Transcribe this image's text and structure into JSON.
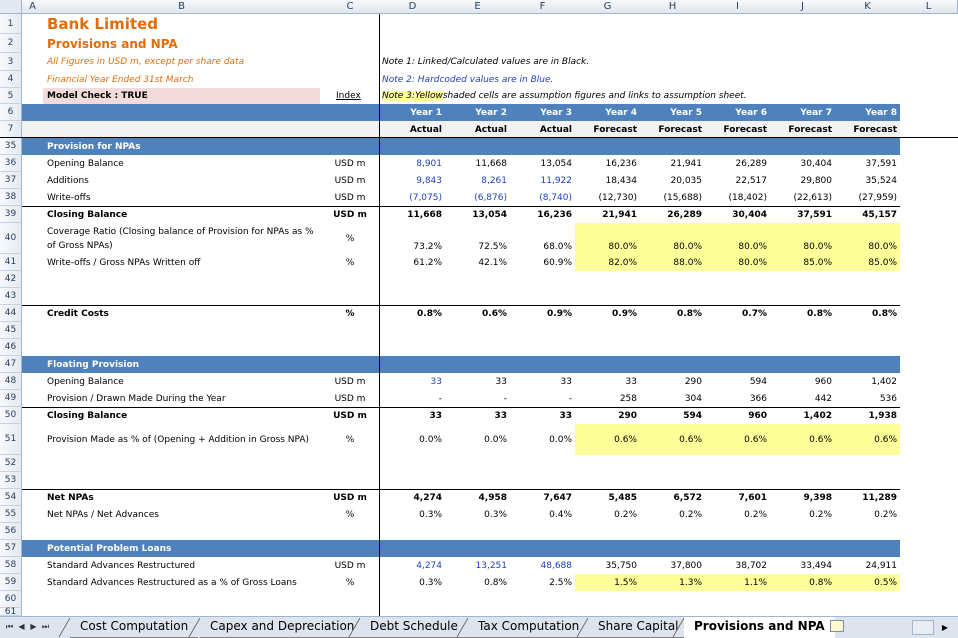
{
  "columns": [
    "A",
    "B",
    "C",
    "D",
    "E",
    "F",
    "G",
    "H",
    "I",
    "J",
    "K",
    "L"
  ],
  "title": "Bank Limited",
  "subtitle": "Provisions and NPA",
  "figures_note": "All Figures in USD m, except per share data",
  "fy_note": "Financial Year Ended 31st March",
  "model_check": "Model Check : TRUE",
  "index_link": "Index",
  "note1": "Note 1: Linked/Calculated values are in Black.",
  "note2": "Note 2: Hardcoded values are in Blue.",
  "note3_prefix": "Note 3: ",
  "note3_yellow": "Yellow",
  "note3_rest": " shaded cells are assumption figures and links to assumption sheet.",
  "years": [
    "Year 1",
    "Year 2",
    "Year 3",
    "Year 4",
    "Year 5",
    "Year 6",
    "Year 7",
    "Year 8"
  ],
  "kinds": [
    "Actual",
    "Actual",
    "Actual",
    "Forecast",
    "Forecast",
    "Forecast",
    "Forecast",
    "Forecast"
  ],
  "row_numbers": [
    "1",
    "2",
    "3",
    "4",
    "5",
    "6",
    "7",
    "35",
    "36",
    "37",
    "38",
    "39",
    "40",
    "41",
    "42",
    "43",
    "44",
    "45",
    "46",
    "47",
    "48",
    "49",
    "50",
    "51",
    "52",
    "53",
    "54",
    "55",
    "56",
    "57",
    "58",
    "59",
    "60",
    "61"
  ],
  "sections": {
    "provision": "Provision for NPAs",
    "floating": "Floating Provision",
    "ppl": "Potential Problem Loans"
  },
  "lines": {
    "opening": {
      "label": "Opening Balance",
      "unit": "USD m",
      "values": [
        "8,901",
        "11,668",
        "13,054",
        "16,236",
        "21,941",
        "26,289",
        "30,404",
        "37,591"
      ]
    },
    "additions": {
      "label": "Additions",
      "unit": "USD m",
      "values": [
        "9,843",
        "8,261",
        "11,922",
        "18,434",
        "20,035",
        "22,517",
        "29,800",
        "35,524"
      ]
    },
    "writeoffs": {
      "label": "Write-offs",
      "unit": "USD m",
      "values": [
        "(7,075)",
        "(6,876)",
        "(8,740)",
        "(12,730)",
        "(15,688)",
        "(18,402)",
        "(22,613)",
        "(27,959)"
      ]
    },
    "closing": {
      "label": "Closing Balance",
      "unit": "USD m",
      "values": [
        "11,668",
        "13,054",
        "16,236",
        "21,941",
        "26,289",
        "30,404",
        "37,591",
        "45,157"
      ]
    },
    "coverage": {
      "label1": "Coverage Ratio (Closing balance of Provision for NPAs as %",
      "label2": "of Gross NPAs)",
      "unit": "%",
      "values": [
        "73.2%",
        "72.5%",
        "68.0%",
        "80.0%",
        "80.0%",
        "80.0%",
        "80.0%",
        "80.0%"
      ]
    },
    "wo_ratio": {
      "label": "Write-offs / Gross NPAs Written off",
      "unit": "%",
      "values": [
        "61.2%",
        "42.1%",
        "60.9%",
        "82.0%",
        "88.0%",
        "80.0%",
        "85.0%",
        "85.0%"
      ]
    },
    "credit": {
      "label": "Credit Costs",
      "unit": "%",
      "values": [
        "0.8%",
        "0.6%",
        "0.9%",
        "0.9%",
        "0.8%",
        "0.7%",
        "0.8%",
        "0.8%"
      ]
    },
    "fp_opening": {
      "label": "Opening Balance",
      "unit": "USD m",
      "values": [
        "33",
        "33",
        "33",
        "33",
        "290",
        "594",
        "960",
        "1,402"
      ]
    },
    "fp_made": {
      "label": "Provision / Drawn Made During the Year",
      "unit": "USD m",
      "values": [
        "-",
        "-",
        "-",
        "258",
        "304",
        "366",
        "442",
        "536"
      ]
    },
    "fp_closing": {
      "label": "Closing Balance",
      "unit": "USD m",
      "values": [
        "33",
        "33",
        "33",
        "290",
        "594",
        "960",
        "1,402",
        "1,938"
      ]
    },
    "fp_pct": {
      "label": "Provision Made as % of (Opening + Addition in Gross NPA)",
      "unit": "%",
      "values": [
        "0.0%",
        "0.0%",
        "0.0%",
        "0.6%",
        "0.6%",
        "0.6%",
        "0.6%",
        "0.6%"
      ]
    },
    "net_npa": {
      "label": "Net NPAs",
      "unit": "USD m",
      "values": [
        "4,274",
        "4,958",
        "7,647",
        "5,485",
        "6,572",
        "7,601",
        "9,398",
        "11,289"
      ]
    },
    "net_ratio": {
      "label": "Net NPAs / Net Advances",
      "unit": "%",
      "values": [
        "0.3%",
        "0.3%",
        "0.4%",
        "0.2%",
        "0.2%",
        "0.2%",
        "0.2%",
        "0.2%"
      ]
    },
    "std_adv": {
      "label": "Standard Advances Restructured",
      "unit": "USD m",
      "values": [
        "4,274",
        "13,251",
        "48,688",
        "35,750",
        "37,800",
        "38,702",
        "33,494",
        "24,911"
      ]
    },
    "std_pct": {
      "label": "Standard Advances Restructured as a % of Gross Loans",
      "unit": "%",
      "values": [
        "0.3%",
        "0.8%",
        "2.5%",
        "1.5%",
        "1.3%",
        "1.1%",
        "0.8%",
        "0.5%"
      ]
    }
  },
  "sheet_tabs": [
    "Cost Computation",
    "Capex and Depreciation",
    "Debt Schedule",
    "Tax Computation",
    "Share Capital",
    "Provisions and NPA"
  ],
  "active_tab": "Provisions and NPA",
  "colors": {
    "section": "#4f81bd",
    "title": "#e36c0a",
    "hardcoded": "#1f3fbf",
    "assumption": "#ffff99",
    "check": "#f2dcdb"
  }
}
